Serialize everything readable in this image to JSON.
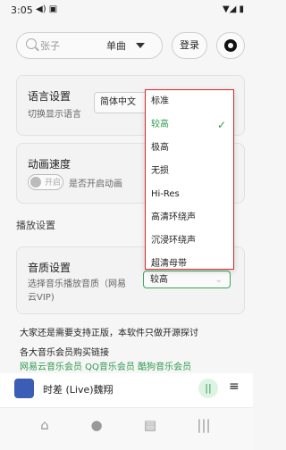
{
  "status_bar": {
    "time": "3:05",
    "left_icons": "◀) ▣",
    "right_icons": "▼◢ ▮"
  },
  "header": {
    "search_placeholder": "张子",
    "search_type": "单曲",
    "login_label": "登录",
    "github_icon": "github-icon"
  },
  "settings": {
    "language": {
      "title": "语言设置",
      "subtitle": "切换显示语言",
      "value": "简体中文"
    },
    "animation": {
      "title": "动画速度",
      "toggle_text": "开启",
      "subtitle": "是否开启动画"
    },
    "section_title": "播放设置",
    "quality": {
      "title": "音质设置",
      "subtitle_line1": "选择音乐播放音质（网易",
      "subtitle_line2": "云VIP)",
      "value": "较高"
    }
  },
  "dropdown": {
    "options": [
      "标准",
      "较高",
      "极高",
      "无损",
      "Hi-Res",
      "高清环绕声",
      "沉浸环绕声",
      "超清母带"
    ],
    "selected_index": 1
  },
  "notice": {
    "line1": "大家还是需要支持正版，本软件只做开源探讨",
    "line2": "各大音乐会员购买链接",
    "links": "网易云音乐会员   QQ音乐会员   酷狗音乐会员"
  },
  "player": {
    "song": "时差 (Live)魏翔",
    "pause_icon": "pause-icon",
    "queue_icon": "queue-icon"
  },
  "nav": {
    "icons": [
      "home-icon",
      "search-icon",
      "list-icon",
      "chart-icon"
    ]
  },
  "colors": {
    "accent": "#2e9a4d",
    "highlight_red": "#d9282b"
  }
}
